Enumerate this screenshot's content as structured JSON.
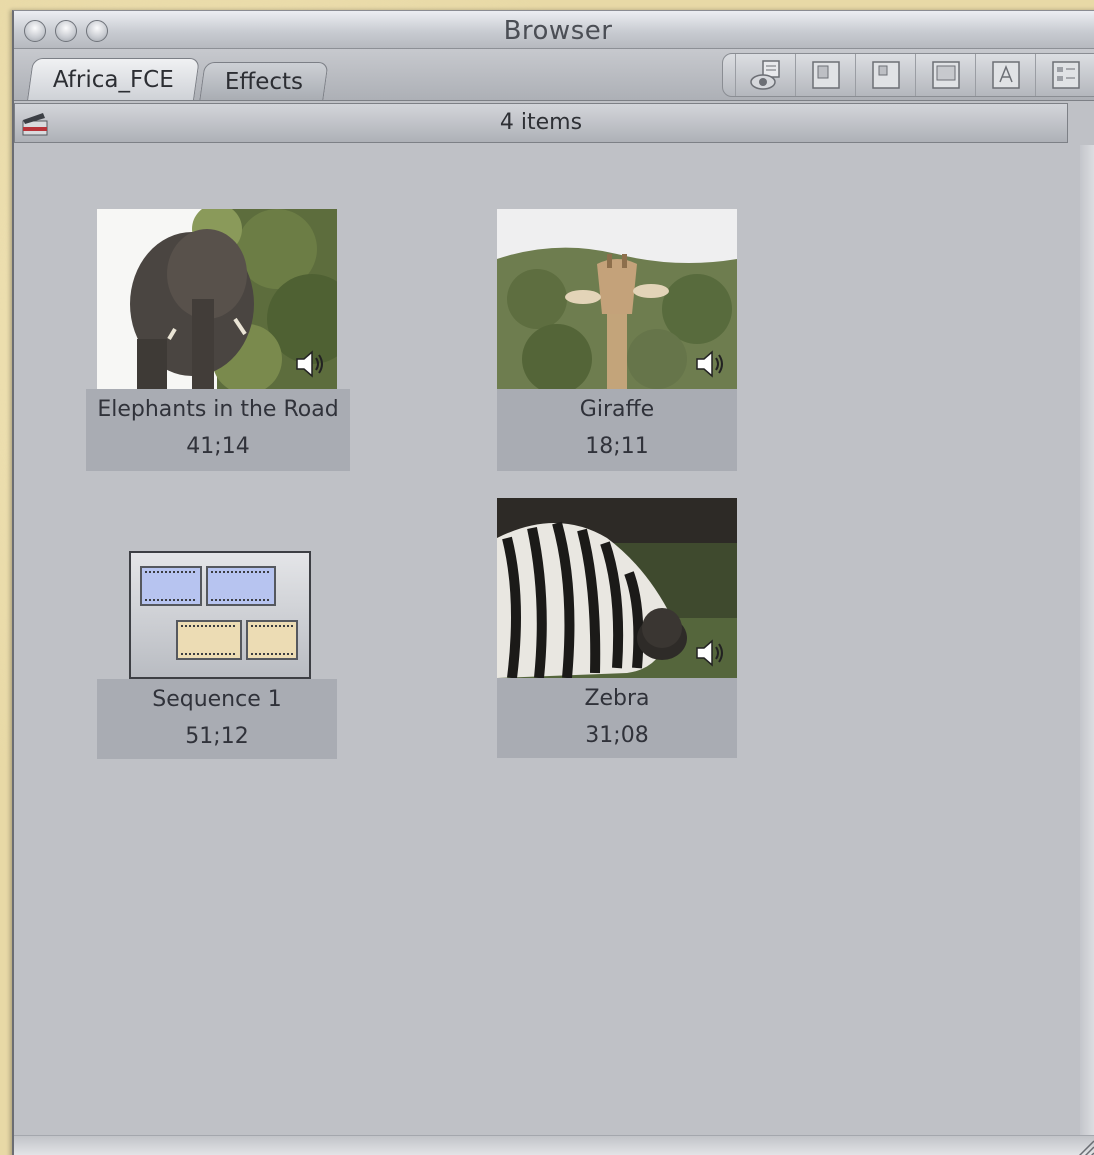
{
  "window": {
    "title": "Browser"
  },
  "tabs": [
    {
      "label": "Africa_FCE",
      "active": true
    },
    {
      "label": "Effects",
      "active": false
    }
  ],
  "toolbar": {
    "buttons": [
      "eye-icon",
      "view-large-icon",
      "view-medium-icon",
      "view-small-icon",
      "text-view-icon",
      "list-view-icon"
    ]
  },
  "status": {
    "count_label": "4 items"
  },
  "items": [
    {
      "name": "Elephants in the Road",
      "duration": "41;14",
      "type": "clip",
      "has_audio": true
    },
    {
      "name": "Giraffe",
      "duration": "18;11",
      "type": "clip",
      "has_audio": true
    },
    {
      "name": "Sequence 1",
      "duration": "51;12",
      "type": "sequence",
      "has_audio": false
    },
    {
      "name": "Zebra",
      "duration": "31;08",
      "type": "clip",
      "has_audio": true
    }
  ],
  "colors": {
    "panel_bg": "#bfc1c6",
    "caption_bg": "#a9acb3",
    "desktop": "#e8d9a6"
  }
}
